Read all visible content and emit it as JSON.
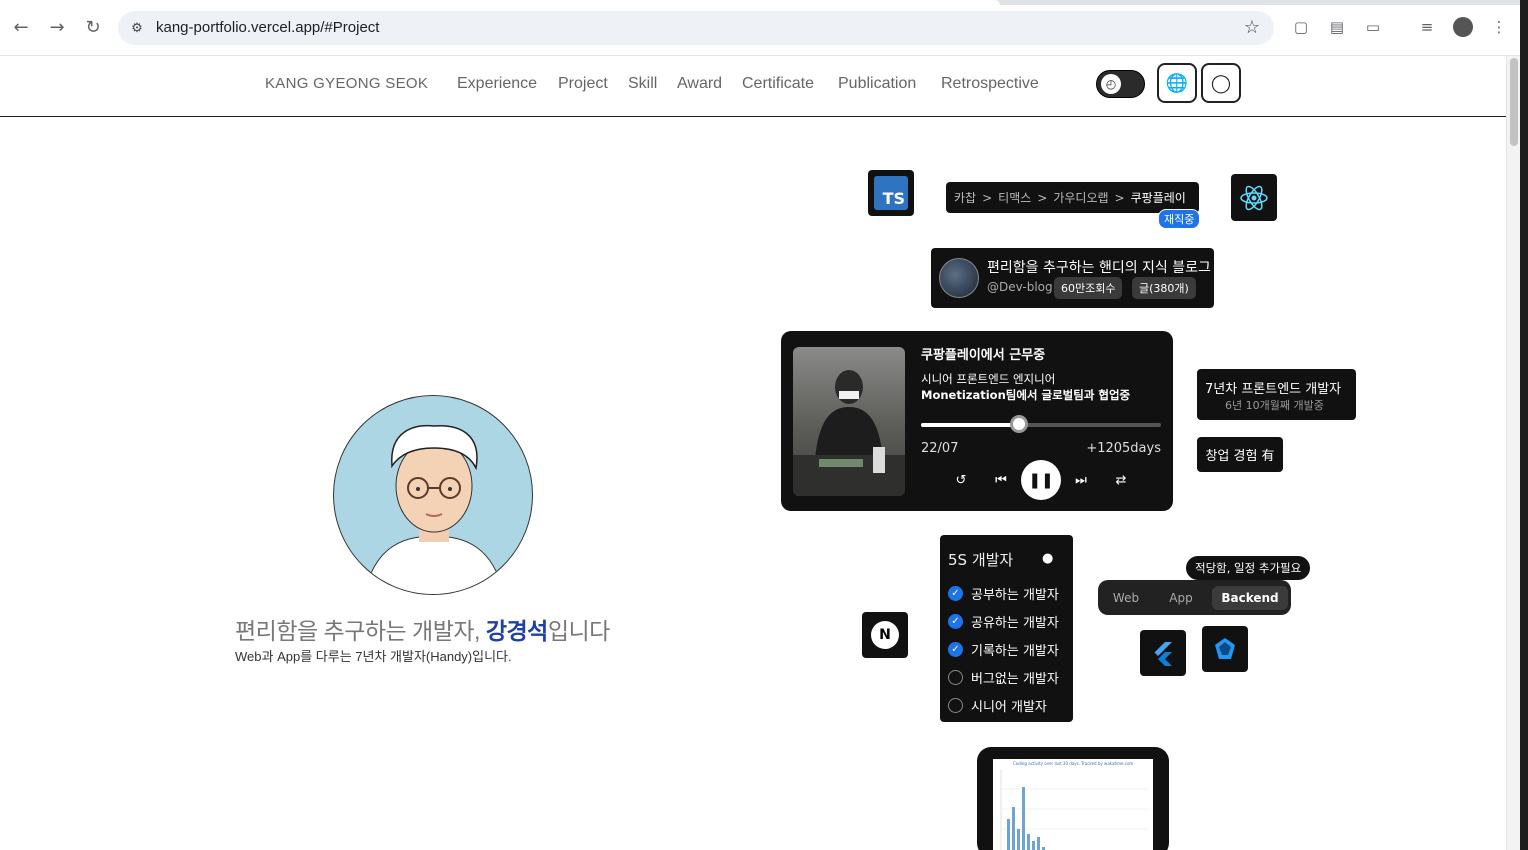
{
  "browser": {
    "url": "kang-portfolio.vercel.app/#Project"
  },
  "site": {
    "logo": "KANG GYEONG SEOK",
    "nav": [
      "Experience",
      "Project",
      "Skill",
      "Award",
      "Certificate",
      "Publication",
      "Retrospective"
    ]
  },
  "hero": {
    "headline_prefix": "편리함을 추구하는 개발자, ",
    "headline_name": "강경석",
    "headline_suffix": "입니다",
    "subline": "Web과 App를 다루는 7년차 개발자(Handy)입니다."
  },
  "career": {
    "breadcrumb": [
      "카찹",
      "티맥스",
      "가우디오랩",
      "쿠팡플레이"
    ],
    "separator": ">",
    "current_badge": "재직중"
  },
  "blog": {
    "title": "편리함을 추구하는 핸디의 지식 블로그",
    "handle": "@Dev-blog",
    "views": "60만조회수",
    "posts": "글(380개)"
  },
  "player": {
    "title": "쿠팡플레이에서 근무중",
    "role": "시니어 프론트엔드 엔지니어",
    "team": "Monetization팀에서 글로벌팀과 협업중",
    "start": "22/07",
    "elapsed": "+1205days",
    "progress": 0.41
  },
  "experience": {
    "title": "7년차 프론트엔드 개발자",
    "sub": "6년 10개월째 개발중",
    "startup": "창업 경험 有"
  },
  "checklist": {
    "title": "5S 개발자",
    "items": [
      {
        "label": "공부하는 개발자",
        "checked": true
      },
      {
        "label": "공유하는 개발자",
        "checked": true
      },
      {
        "label": "기록하는 개발자",
        "checked": true
      },
      {
        "label": "버그없는 개발자",
        "checked": false
      },
      {
        "label": "시니어 개발자",
        "checked": false
      }
    ]
  },
  "skills": {
    "tooltip": "적당함, 일정 추가필요",
    "tabs": [
      "Web",
      "App",
      "Backend"
    ],
    "active_tab": "Backend"
  },
  "tiles": {
    "ts": "TS",
    "next": "N"
  },
  "chart_caption": "Coding activity over last 30 days. Tracked by wakatime.com",
  "colors": {
    "accent": "#1e73e8",
    "headline_name": "#1e3fa8",
    "card_bg": "#111111"
  }
}
